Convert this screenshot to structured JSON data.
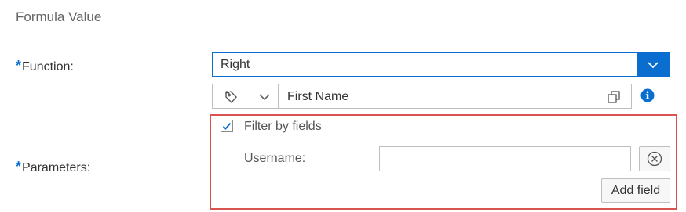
{
  "section": {
    "title": "Formula Value"
  },
  "function_field": {
    "required_marker": "*",
    "label": "Function:",
    "value": "Right",
    "icon": "chevron-down-icon"
  },
  "parameter_field": {
    "type_icon": "tag-icon",
    "type_dropdown_icon": "chevron-down-icon",
    "value": "First Name",
    "value_help_icon": "copy-icon",
    "info_icon": "info-icon"
  },
  "parameters_field": {
    "required_marker": "*",
    "label": "Parameters:"
  },
  "filter": {
    "checkbox_label": "Filter by fields",
    "checked": true,
    "username_label": "Username:",
    "username_value": "",
    "clear_icon": "clear-icon",
    "add_field_label": "Add field"
  },
  "colors": {
    "accent": "#0a6ed1",
    "highlight_border": "#d9534f"
  }
}
